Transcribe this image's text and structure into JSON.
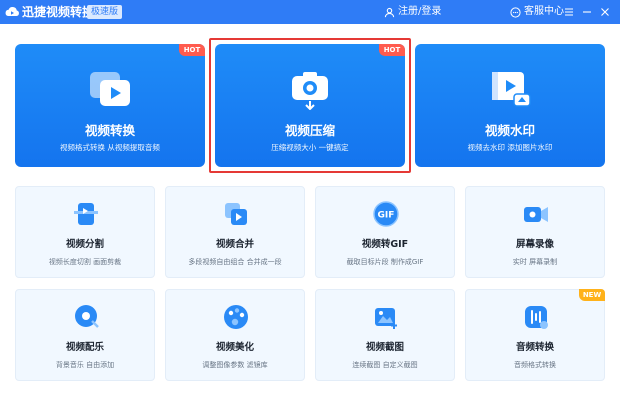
{
  "titlebar": {
    "app_name": "迅捷视频转换器",
    "edition_badge": "极速版",
    "login_label": "注册/登录",
    "service_label": "客服中心"
  },
  "feature_cards": [
    {
      "title": "视频转换",
      "subtitle": "视频格式转换 从视频提取音频",
      "icon": "video-convert-icon",
      "badge": "HOT"
    },
    {
      "title": "视频压缩",
      "subtitle": "压缩视频大小 一键搞定",
      "icon": "video-compress-icon",
      "badge": "HOT"
    },
    {
      "title": "视频水印",
      "subtitle": "视频去水印 添加图片水印",
      "icon": "video-watermark-icon"
    }
  ],
  "tool_cards": [
    {
      "title": "视频分割",
      "subtitle": "视频长度切割 画面剪裁",
      "icon": "video-split-icon"
    },
    {
      "title": "视频合并",
      "subtitle": "多段视频自由组合 合并成一段",
      "icon": "video-merge-icon"
    },
    {
      "title": "视频转GIF",
      "subtitle": "截取目标片段 制作成GIF",
      "icon": "gif-icon"
    },
    {
      "title": "屏幕录像",
      "subtitle": "实时 屏幕录制",
      "icon": "screen-record-icon"
    },
    {
      "title": "视频配乐",
      "subtitle": "背景音乐 自由添加",
      "icon": "music-icon"
    },
    {
      "title": "视频美化",
      "subtitle": "调整图像参数 滤镜库",
      "icon": "palette-icon"
    },
    {
      "title": "视频截图",
      "subtitle": "连续截图 自定义截图",
      "icon": "screenshot-icon"
    },
    {
      "title": "音频转换",
      "subtitle": "音频格式转换",
      "icon": "audio-convert-icon",
      "badge": "NEW"
    }
  ],
  "colors": {
    "titlebar": "#2f7cf6",
    "card_blue": "#1f8cf8",
    "hot_badge": "#ff5b4e",
    "new_badge": "#ffb21a",
    "selection": "#e53935",
    "tile_bg": "#f1f8ff"
  }
}
